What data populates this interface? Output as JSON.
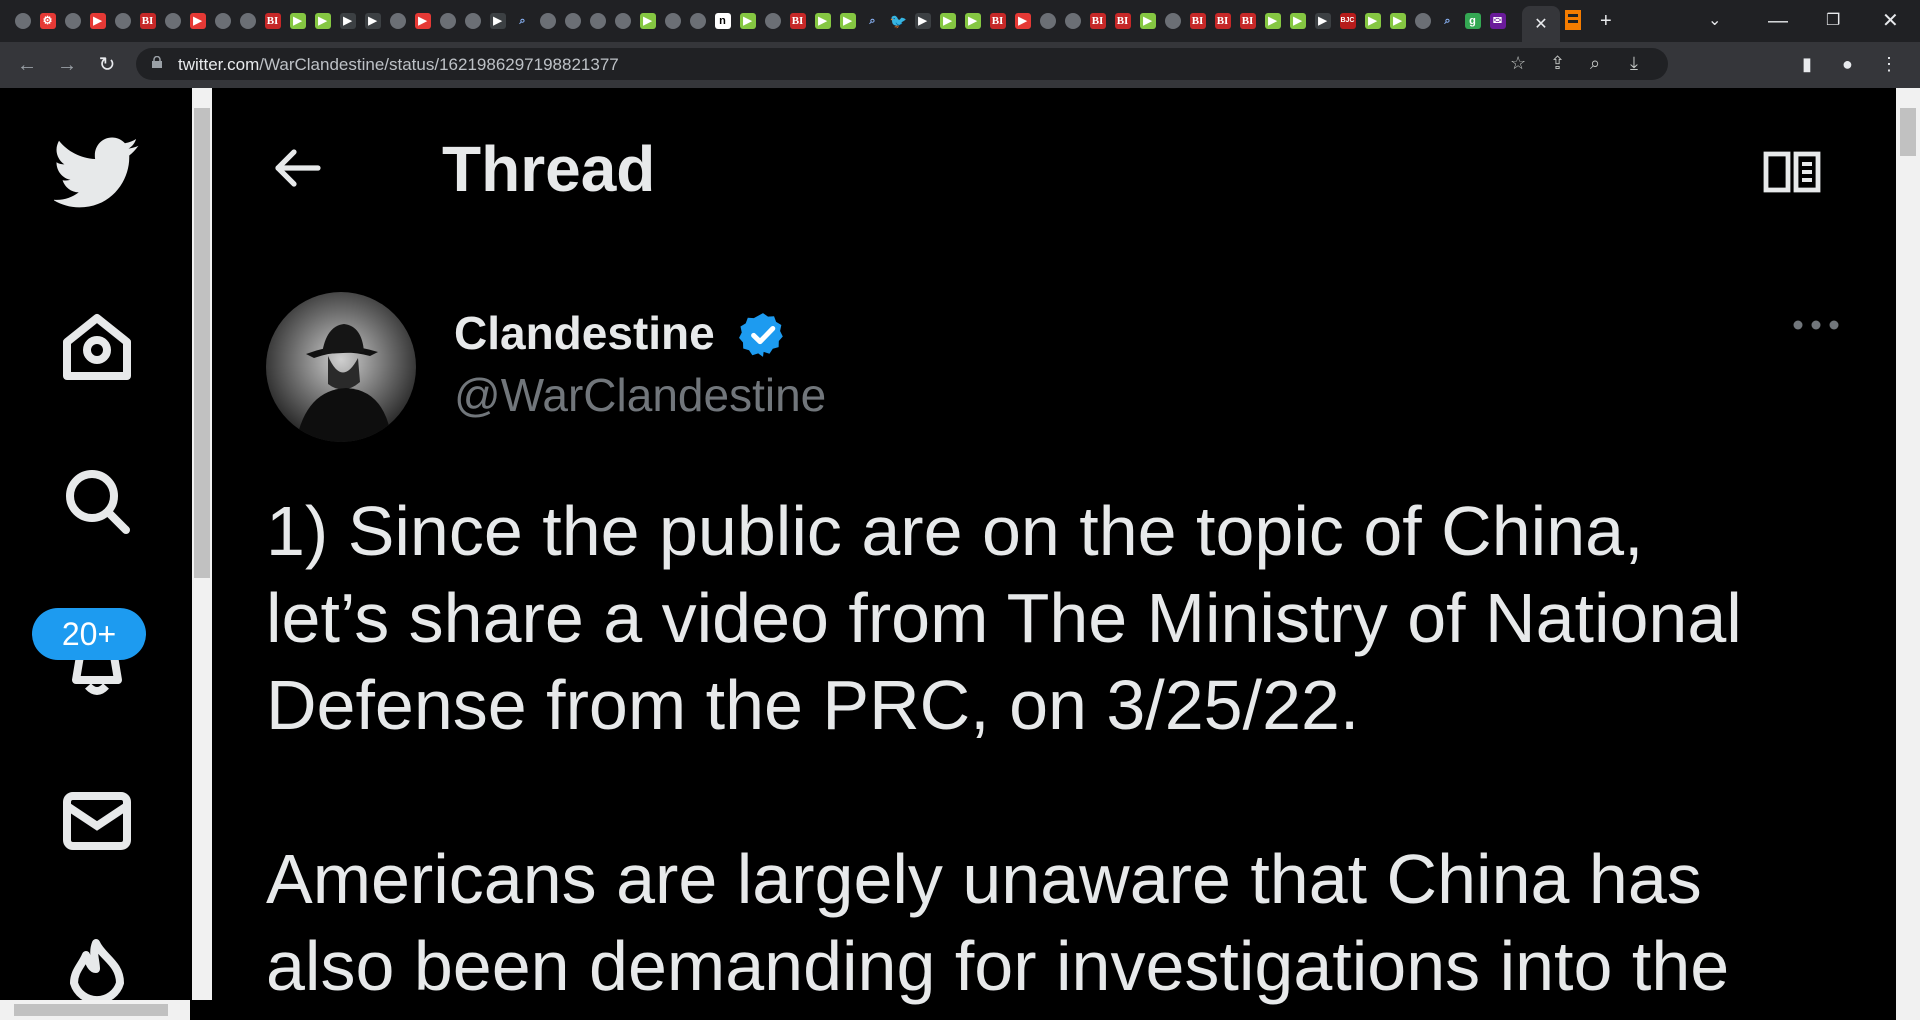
{
  "browser": {
    "url_host": "twitter.com",
    "url_path": "/WarClandestine/status/1621986297198821377",
    "tab_favicons": [
      "globe-icon",
      "gear-icon",
      "globe-icon",
      "youtube-icon",
      "globe-icon",
      "bi-icon",
      "globe-icon",
      "youtube-icon",
      "globe-icon",
      "globe-icon",
      "bi-icon",
      "rumble-icon",
      "rumble-icon",
      "dark-icon",
      "dark-icon",
      "globe-icon",
      "youtube-icon",
      "globe-icon",
      "globe-icon",
      "dark-icon",
      "search-icon",
      "globe-icon",
      "globe-icon",
      "globe-icon",
      "globe-icon",
      "rumble-icon",
      "globe-icon",
      "globe-icon",
      "n-icon",
      "rumble-icon",
      "globe-icon",
      "bi-icon",
      "rumble-icon",
      "rumble-icon",
      "search-icon",
      "twitter-icon",
      "dark-icon",
      "rumble-icon",
      "rumble-icon",
      "bi-icon",
      "youtube-icon",
      "globe-icon",
      "globe-icon",
      "bi-icon",
      "bi-icon",
      "rumble-icon",
      "globe-icon",
      "bi-icon",
      "bi-icon",
      "bi-icon",
      "rumble-icon",
      "rumble-icon",
      "dark-icon",
      "bjc-icon",
      "rumble-icon",
      "rumble-icon",
      "globe-icon",
      "search-icon",
      "g-icon",
      "mail-icon"
    ],
    "bi_label": "BI",
    "n_label": "n",
    "g_label": "g",
    "bjc_label": "BJC"
  },
  "nav": {
    "notification_badge": "20+"
  },
  "header": {
    "title": "Thread"
  },
  "tweet": {
    "display_name": "Clandestine",
    "handle": "@WarClandestine",
    "text": "1) Since the public are on the topic of China,\nlet’s share a video from The Ministry of National\nDefense from the PRC, on 3/25/22.\n\nAmericans are largely unaware that China has\nalso been demanding for investigations into the"
  },
  "colors": {
    "accent": "#1d9bf0",
    "text_primary": "#e7e9ea",
    "text_secondary": "#71767b",
    "background": "#000000"
  }
}
